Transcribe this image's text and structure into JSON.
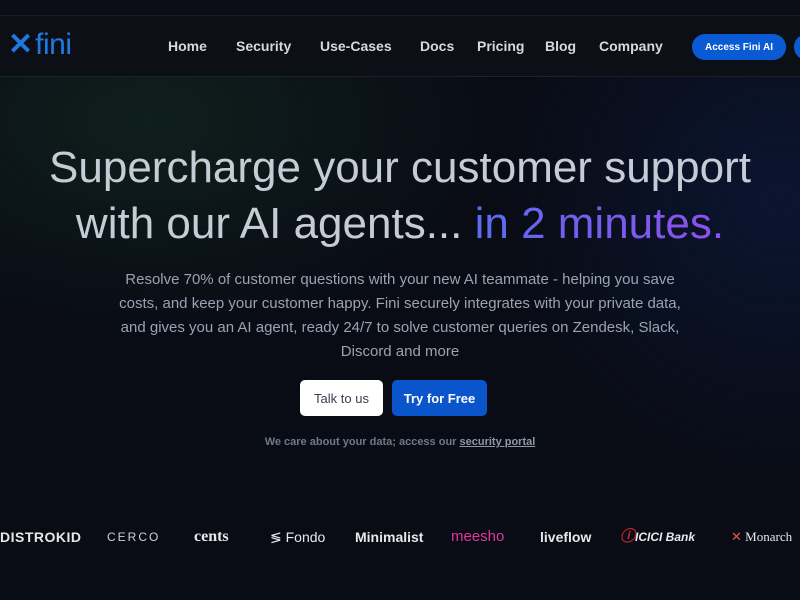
{
  "nav": {
    "brand": "fini",
    "links": [
      "Home",
      "Security",
      "Use-Cases",
      "Docs",
      "Pricing",
      "Blog",
      "Company"
    ],
    "cta": "Access Fini AI"
  },
  "hero": {
    "title_line1": "Supercharge your customer support",
    "title_line2_plain": "with our AI agents... ",
    "title_line2_highlight": "in 2 minutes.",
    "subtitle": "Resolve 70% of customer questions with your new AI teammate - helping you save costs, and keep your customer happy. Fini securely integrates with your private data, and gives you an AI agent, ready 24/7 to solve customer queries on Zendesk, Slack, Discord and more",
    "talk_button": "Talk to us",
    "try_button": "Try for Free",
    "care_text": "We care about your data; access our ",
    "care_link": "security portal"
  },
  "logos": [
    "DISTROKID",
    "CERCO",
    "cents",
    "Fondo",
    "Minimalist",
    "meesho",
    "liveflow",
    "ICICI Bank",
    "Monarch"
  ],
  "colors": {
    "accent": "#0a55cc",
    "meesho": "#e0359a",
    "icici": "#c0262d"
  }
}
